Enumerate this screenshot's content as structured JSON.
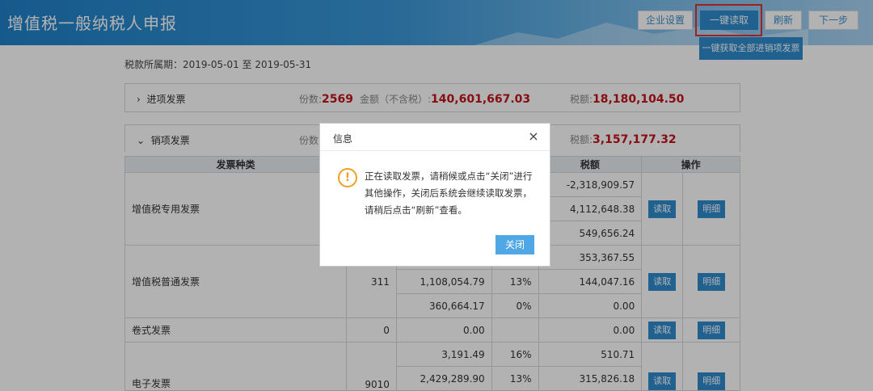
{
  "header": {
    "title": "增值税一般纳税人申报",
    "buttons": [
      "企业设置",
      "一键读取",
      "刷新",
      "下一步"
    ],
    "sub_button": "一键获取全部进销项发票"
  },
  "period": "税款所属期：2019-05-01 至 2019-05-31",
  "input_panel": {
    "label": "进项发票",
    "count_label": "份数:",
    "count": "2569",
    "amount_label": "金额（不含税）:",
    "amount": "140,601,667.03",
    "tax_label": "税额:",
    "tax": "18,180,104.50"
  },
  "output_panel": {
    "label": "销项发票",
    "count_label": "份数",
    "tax_label": "税额:",
    "tax": "3,157,177.32"
  },
  "table": {
    "headers": [
      "发票种类",
      "税额",
      "操作"
    ],
    "read_label": "读取",
    "detail_label": "明细",
    "rows": [
      {
        "type": "增值税专用发票",
        "taxes": [
          "-2,318,909.57",
          "4,112,648.38",
          "549,656.24"
        ]
      },
      {
        "type": "增值税普通发票",
        "count": "311",
        "amounts": [
          "",
          "1,108,054.79",
          "360,664.17"
        ],
        "rates": [
          "",
          "13%",
          "0%"
        ],
        "taxes": [
          "353,367.55",
          "144,047.16",
          "0.00"
        ]
      },
      {
        "type": "卷式发票",
        "count": "0",
        "amounts": [
          "0.00"
        ],
        "taxes": [
          "0.00"
        ]
      },
      {
        "type": "电子发票",
        "count": "9010",
        "amounts": [
          "3,191.49",
          "2,429,289.90"
        ],
        "rates": [
          "16%",
          "13%"
        ],
        "taxes": [
          "510.71",
          "315,826.18"
        ]
      }
    ]
  },
  "dialog": {
    "title": "信息",
    "close_icon": "×",
    "warning_icon": "!",
    "message": "正在读取发票，请稍候或点击“关闭”进行其他操作，关闭后系统会继续读取发票，请稍后点击“刷新”查看。",
    "ok_label": "关闭"
  },
  "colors": {
    "header_blue": "#2e8ccf",
    "amount_red": "#c2141b",
    "warning_orange": "#f0a020"
  }
}
